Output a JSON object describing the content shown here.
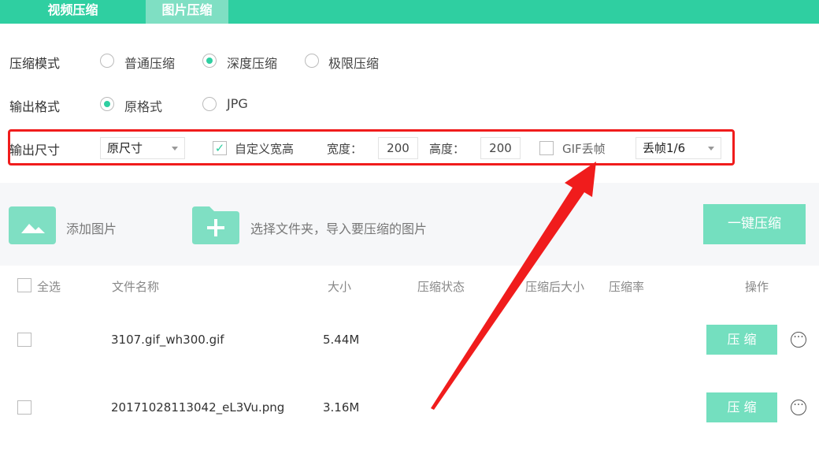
{
  "tabs": [
    {
      "label": "视频压缩"
    },
    {
      "label": "图片压缩"
    }
  ],
  "mode": {
    "label": "压缩模式",
    "options": [
      {
        "label": "普通压缩",
        "selected": false
      },
      {
        "label": "深度压缩",
        "selected": true
      },
      {
        "label": "极限压缩",
        "selected": false
      }
    ]
  },
  "format": {
    "label": "输出格式",
    "options": [
      {
        "label": "原格式",
        "selected": true
      },
      {
        "label": "JPG",
        "selected": false
      }
    ]
  },
  "size": {
    "label": "输出尺寸",
    "select": "原尺寸",
    "custom_label": "自定义宽高",
    "custom_checked": true,
    "width_label": "宽度：",
    "width": "200",
    "height_label": "高度：",
    "height": "200",
    "gif_label": "GIF丢帧",
    "gif_checked": false,
    "gif_select": "丢帧1/6"
  },
  "actions": {
    "add_image": "添加图片",
    "add_folder": "选择文件夹，导入要压缩的图片",
    "compress_all": "一键压缩"
  },
  "table": {
    "headers": {
      "select_all": "全选",
      "name": "文件名称",
      "size": "大小",
      "status": "压缩状态",
      "after": "压缩后大小",
      "ratio": "压缩率",
      "ops": "操作"
    },
    "rows": [
      {
        "name": "3107.gif_wh300.gif",
        "size": "5.44M",
        "button": "压 缩"
      },
      {
        "name": "20171028113042_eL3Vu.png",
        "size": "3.16M",
        "button": "压 缩"
      }
    ]
  },
  "colors": {
    "accent": "#2fcfa1",
    "annotation": "#f01c1c"
  }
}
